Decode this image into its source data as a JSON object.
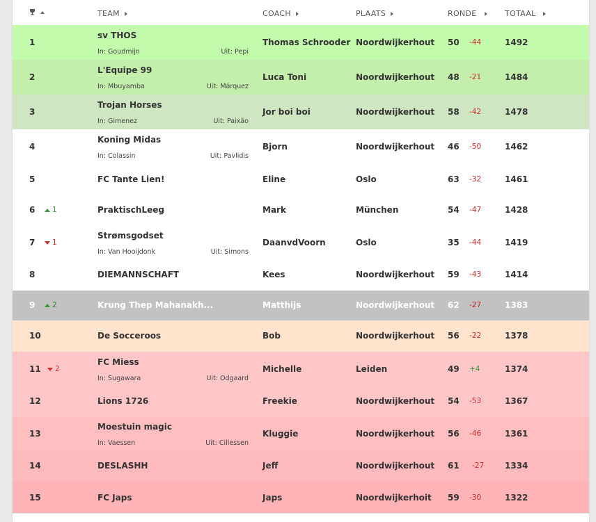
{
  "header": {
    "team": "TEAM",
    "coach": "COACH",
    "plaats": "PLAATS",
    "ronde": "RONDE",
    "totaal": "TOTAAL"
  },
  "colors": {
    "green_light": "#c3fbad",
    "green_mid": "#c3eeab",
    "green_soft": "#cfe6c2",
    "white": "#ffffff",
    "gray": "#c2c2c2",
    "orange": "#ffe3cd",
    "pink": "#ffc6c8",
    "pink_dark": "#ffb5b8",
    "up": "#3a9a3a",
    "down": "#d02c2c"
  },
  "rows": [
    {
      "rank": "1",
      "move": "",
      "team": "sv THOS",
      "in": "In: Goudmijn",
      "uit": "Uit: Pepi",
      "coach": "Thomas Schrooder",
      "place": "Noordwijkerhout",
      "ronde": "50",
      "delta": "-44",
      "total": "1492"
    },
    {
      "rank": "2",
      "move": "",
      "team": "L'Equipe 99",
      "in": "In: Mbuyamba",
      "uit": "Uit: Márquez",
      "coach": "Luca Toni",
      "place": "Noordwijkerhout",
      "ronde": "48",
      "delta": "-21",
      "total": "1484"
    },
    {
      "rank": "3",
      "move": "",
      "team": "Trojan Horses",
      "in": "In: Gimenez",
      "uit": "Uit: Paixão",
      "coach": "Jor boi boi",
      "place": "Noordwijkerhout",
      "ronde": "58",
      "delta": "-42",
      "total": "1478"
    },
    {
      "rank": "4",
      "move": "",
      "team": "Koning Midas",
      "in": "In: Colassin",
      "uit": "Uit: Pavlidis",
      "coach": "Bjorn",
      "place": "Noordwijkerhout",
      "ronde": "46",
      "delta": "-50",
      "total": "1462"
    },
    {
      "rank": "5",
      "move": "",
      "team": "FC Tante Lien!",
      "in": "",
      "uit": "",
      "coach": "Eline",
      "place": "Oslo",
      "ronde": "63",
      "delta": "-32",
      "total": "1461"
    },
    {
      "rank": "6",
      "move": "1",
      "team": "PraktischLeeg",
      "in": "",
      "uit": "",
      "coach": "Mark",
      "place": "München",
      "ronde": "54",
      "delta": "-47",
      "total": "1428"
    },
    {
      "rank": "7",
      "move": "1",
      "team": "Strømsgodset",
      "in": "In: Van Hooijdonk",
      "uit": "Uit: Simons",
      "coach": "DaanvdVoorn",
      "place": "Oslo",
      "ronde": "35",
      "delta": "-44",
      "total": "1419"
    },
    {
      "rank": "8",
      "move": "",
      "team": "DIEMANNSCHAFT",
      "in": "",
      "uit": "",
      "coach": "Kees",
      "place": "Noordwijkerhout",
      "ronde": "59",
      "delta": "-43",
      "total": "1414"
    },
    {
      "rank": "9",
      "move": "2",
      "team": "Krung Thep Mahanakh...",
      "in": "",
      "uit": "",
      "coach": "Matthijs",
      "place": "Noordwijkerhout",
      "ronde": "62",
      "delta": "-27",
      "total": "1383"
    },
    {
      "rank": "10",
      "move": "",
      "team": "De Socceroos",
      "in": "",
      "uit": "",
      "coach": "Bob",
      "place": "Noordwijkerhout",
      "ronde": "56",
      "delta": "-22",
      "total": "1378"
    },
    {
      "rank": "11",
      "move": "2",
      "team": "FC Miess",
      "in": "In: Sugawara",
      "uit": "Uit: Odgaard",
      "coach": "Michelle",
      "place": "Leiden",
      "ronde": "49",
      "delta": "+4",
      "total": "1374"
    },
    {
      "rank": "12",
      "move": "",
      "team": "Lions 1726",
      "in": "",
      "uit": "",
      "coach": "Freekie",
      "place": "Noordwijkerhout",
      "ronde": "54",
      "delta": "-53",
      "total": "1367"
    },
    {
      "rank": "13",
      "move": "",
      "team": "Moestuin magic",
      "in": "In: Vaessen",
      "uit": "Uit: Cillessen",
      "coach": "Kluggie",
      "place": "Noordwijkerhout",
      "ronde": "56",
      "delta": "-46",
      "total": "1361"
    },
    {
      "rank": "14",
      "move": "",
      "team": "DESLASHH",
      "in": "",
      "uit": "",
      "coach": "Jeff",
      "place": "Noordwijkerhout",
      "ronde": "61",
      "delta": "-27",
      "total": "1334"
    },
    {
      "rank": "15",
      "move": "",
      "team": "FC Japs",
      "in": "",
      "uit": "",
      "coach": "Japs",
      "place": "Noordwijkerhoit",
      "ronde": "59",
      "delta": "-30",
      "total": "1322"
    }
  ]
}
